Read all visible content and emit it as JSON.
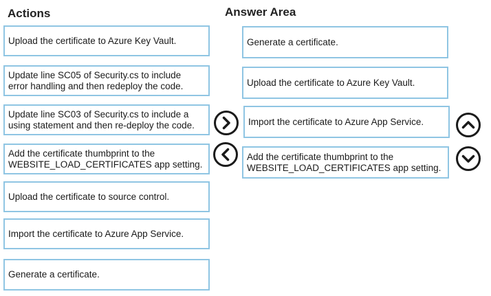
{
  "actions": {
    "heading": "Actions",
    "items": [
      {
        "line1": "Upload the certificate to Azure Key Vault.",
        "line2": ""
      },
      {
        "line1": "Update line SC05 of Security.cs to include",
        "line2": "error handling and then redeploy the code."
      },
      {
        "line1": "Update line SC03 of Security.cs to include a",
        "line2": "using statement and then re-deploy the code."
      },
      {
        "line1": "Add the certificate thumbprint to the",
        "line2": "WEBSITE_LOAD_CERTIFICATES app setting."
      },
      {
        "line1": "Upload the certificate to source control.",
        "line2": ""
      },
      {
        "line1": "Import the certificate to Azure App Service.",
        "line2": ""
      },
      {
        "line1": "Generate a certificate.",
        "line2": ""
      }
    ]
  },
  "answer_area": {
    "heading": "Answer Area",
    "items": [
      {
        "line1": "Generate a certificate.",
        "line2": ""
      },
      {
        "line1": "Upload the certificate to Azure Key Vault.",
        "line2": ""
      },
      {
        "line1": "Import the certificate to Azure App Service.",
        "line2": ""
      },
      {
        "line1": "Add the certificate thumbprint to the",
        "line2": "WEBSITE_LOAD_CERTIFICATES app setting."
      }
    ]
  },
  "controls": {
    "move_right_icon": "chevron-right-icon",
    "move_left_icon": "chevron-left-icon",
    "move_up_icon": "chevron-up-icon",
    "move_down_icon": "chevron-down-icon"
  },
  "colors": {
    "card_border": "#8fc5e3",
    "icon_stroke": "#1a1a1a"
  }
}
